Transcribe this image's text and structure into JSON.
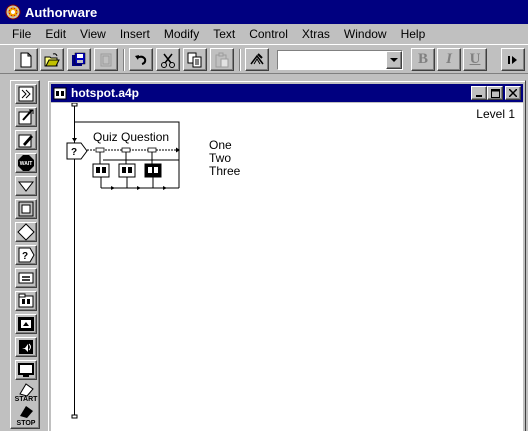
{
  "app": {
    "title": "Authorware",
    "icon": "authorware-app-icon"
  },
  "menu": [
    {
      "label": "File"
    },
    {
      "label": "Edit"
    },
    {
      "label": "View"
    },
    {
      "label": "Insert"
    },
    {
      "label": "Modify"
    },
    {
      "label": "Text"
    },
    {
      "label": "Control"
    },
    {
      "label": "Xtras"
    },
    {
      "label": "Window"
    },
    {
      "label": "Help"
    }
  ],
  "toolbar": {
    "buttons": [
      "new-file-icon",
      "open-file-icon",
      "save-all-icon",
      "import-icon",
      "undo-icon",
      "cut-icon",
      "copy-icon",
      "paste-icon",
      "find-icon"
    ],
    "style_value": "",
    "format": {
      "bold": "B",
      "italic": "I",
      "underline": "U"
    }
  },
  "palette": {
    "icons": [
      "display-icon",
      "motion-icon",
      "erase-icon",
      "wait-icon",
      "navigate-icon",
      "framework-icon",
      "decision-icon",
      "interaction-icon",
      "calculation-icon",
      "map-icon",
      "digital-movie-icon",
      "sound-icon",
      "video-icon",
      "start-flag-icon",
      "stop-flag-icon"
    ],
    "wait_text": "WAIT",
    "start_label": "START",
    "stop_label": "STOP"
  },
  "document": {
    "title": "hotspot.a4p",
    "level": "Level 1",
    "interaction": {
      "title": "Quiz Question",
      "responses": [
        {
          "label": "One",
          "icon": "map-icon"
        },
        {
          "label": "Two",
          "icon": "map-icon"
        },
        {
          "label": "Three",
          "icon": "map-icon-selected"
        }
      ]
    }
  }
}
